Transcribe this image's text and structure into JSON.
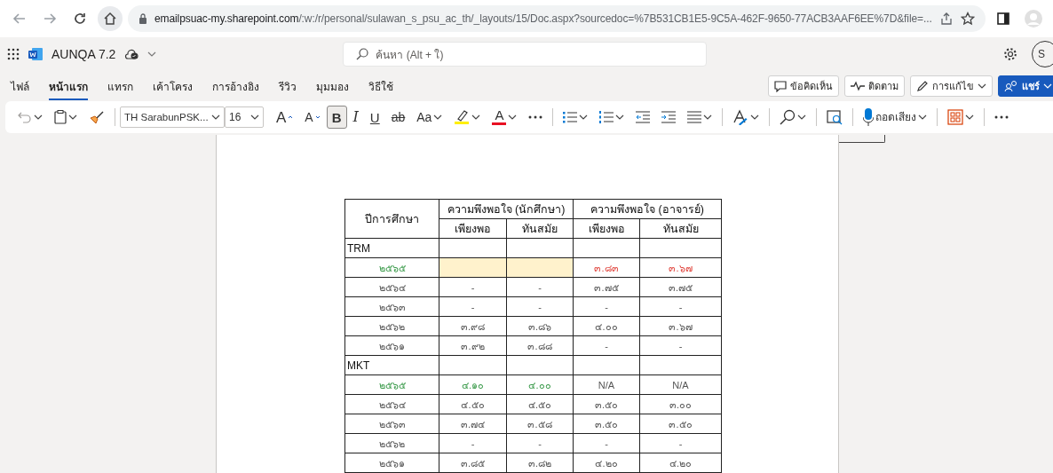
{
  "browser": {
    "url_host": "emailpsuac-my.sharepoint.com",
    "url_path": "/:w:/r/personal/sulawan_s_psu_ac_th/_layouts/15/Doc.aspx?sourcedoc=%7B531CB1E5-9C5A-462F-9650-77ACB3AAF6EE%7D&file=..."
  },
  "app": {
    "title": "AUNQA 7.2",
    "search": {
      "placeholder": "ค้นหา (Alt + ใ)"
    },
    "avatar": "S"
  },
  "ribbon_tabs": [
    {
      "label": "ไฟล์",
      "selected": false
    },
    {
      "label": "หน้าแรก",
      "selected": true
    },
    {
      "label": "แทรก",
      "selected": false
    },
    {
      "label": "เค้าโครง",
      "selected": false
    },
    {
      "label": "การอ้างอิง",
      "selected": false
    },
    {
      "label": "รีวิว",
      "selected": false
    },
    {
      "label": "มุมมอง",
      "selected": false
    },
    {
      "label": "วิธีใช้",
      "selected": false
    }
  ],
  "ribbon_actions": [
    {
      "kind": "comments",
      "label": "ข้อคิดเห็น"
    },
    {
      "kind": "catch-up",
      "label": "ติดตาม"
    },
    {
      "kind": "editing",
      "label": "การแก้ไข"
    },
    {
      "kind": "share",
      "label": "แชร์"
    }
  ],
  "toolbar": {
    "font": "TH SarabunPSK...",
    "size": "16",
    "items": [
      {
        "kind": "grow",
        "label": "A",
        "pressed": false
      },
      {
        "kind": "shrink",
        "label": "A",
        "pressed": false
      },
      {
        "kind": "bold",
        "label": "B",
        "pressed": true
      },
      {
        "kind": "italic",
        "label": "I",
        "pressed": false
      },
      {
        "kind": "underline",
        "label": "U",
        "pressed": false
      },
      {
        "kind": "strike",
        "label": "ab",
        "pressed": false
      },
      {
        "kind": "case",
        "label": "Aa",
        "pressed": false
      },
      {
        "kind": "highlight",
        "pressed": false
      },
      {
        "kind": "fontcolor",
        "label": "A",
        "pressed": false
      },
      {
        "kind": "more",
        "pressed": false
      },
      {
        "kind": "bullets",
        "pressed": false
      },
      {
        "kind": "numbering",
        "pressed": false
      },
      {
        "kind": "outdent",
        "pressed": false
      },
      {
        "kind": "indent",
        "pressed": false
      },
      {
        "kind": "align",
        "pressed": false
      },
      {
        "kind": "styles",
        "pressed": false
      },
      {
        "kind": "find",
        "pressed": false
      },
      {
        "kind": "designer",
        "pressed": false
      },
      {
        "kind": "dictate",
        "label": "ถอดเสียง",
        "pressed": false
      },
      {
        "kind": "addins",
        "pressed": false
      },
      {
        "kind": "more",
        "pressed": false
      }
    ]
  },
  "table": {
    "header": [
      "ปีการศึกษา",
      "ความพึงพอใจ (นักศึกษา)",
      "ความพึงพอใจ (อาจารย์)"
    ],
    "subheader": [
      "เพียงพอ",
      "ทันสมัย",
      "เพียงพอ",
      "ทันสมัย"
    ],
    "rows": [
      {
        "kind": "group",
        "label": "TRM"
      },
      {
        "kind": "data",
        "cells": [
          {
            "text": "๒๕๖๕",
            "color": "#3a9a4a",
            "highlighted": false
          },
          {
            "text": "",
            "highlighted": true
          },
          {
            "text": "",
            "highlighted": true
          },
          {
            "text": "๓.๘๓",
            "color": "#e0443c",
            "highlighted": false
          },
          {
            "text": "๓.๖๗",
            "color": "#e0443c",
            "highlighted": false
          }
        ]
      },
      {
        "kind": "data",
        "cells": [
          {
            "text": "๒๕๖๔",
            "highlighted": false
          },
          {
            "text": "-",
            "highlighted": false
          },
          {
            "text": "-",
            "highlighted": false
          },
          {
            "text": "๓.๗๕",
            "highlighted": false
          },
          {
            "text": "๓.๗๕",
            "highlighted": false
          }
        ]
      },
      {
        "kind": "data",
        "cells": [
          {
            "text": "๒๕๖๓",
            "highlighted": false
          },
          {
            "text": "-",
            "highlighted": false
          },
          {
            "text": "-",
            "highlighted": false
          },
          {
            "text": "-",
            "highlighted": false
          },
          {
            "text": "-",
            "highlighted": false
          }
        ]
      },
      {
        "kind": "data",
        "cells": [
          {
            "text": "๒๕๖๒",
            "highlighted": false
          },
          {
            "text": "๓.๙๘",
            "highlighted": false
          },
          {
            "text": "๓.๘๖",
            "highlighted": false
          },
          {
            "text": "๔.๐๐",
            "highlighted": false
          },
          {
            "text": "๓.๖๗",
            "highlighted": false
          }
        ]
      },
      {
        "kind": "data",
        "cells": [
          {
            "text": "๒๕๖๑",
            "highlighted": false
          },
          {
            "text": "๓.๙๒",
            "highlighted": false
          },
          {
            "text": "๓.๘๘",
            "highlighted": false
          },
          {
            "text": "-",
            "highlighted": false
          },
          {
            "text": "-",
            "highlighted": false
          }
        ]
      },
      {
        "kind": "group",
        "label": "MKT"
      },
      {
        "kind": "data",
        "cells": [
          {
            "text": "๒๕๖๕",
            "color": "#3a9a4a",
            "highlighted": false
          },
          {
            "text": "๔.๑๐",
            "color": "#3a9a4a",
            "highlighted": false
          },
          {
            "text": "๔.๐๐",
            "color": "#3a9a4a",
            "highlighted": false
          },
          {
            "text": "N/A",
            "highlighted": false
          },
          {
            "text": "N/A",
            "highlighted": false
          }
        ]
      },
      {
        "kind": "data",
        "cells": [
          {
            "text": "๒๕๖๔",
            "highlighted": false
          },
          {
            "text": "๔.๕๐",
            "highlighted": false
          },
          {
            "text": "๔.๕๐",
            "highlighted": false
          },
          {
            "text": "๓.๕๐",
            "highlighted": false
          },
          {
            "text": "๓.๐๐",
            "highlighted": false
          }
        ]
      },
      {
        "kind": "data",
        "cells": [
          {
            "text": "๒๕๖๓",
            "highlighted": false
          },
          {
            "text": "๓.๗๔",
            "highlighted": false
          },
          {
            "text": "๓.๕๘",
            "highlighted": false
          },
          {
            "text": "๓.๕๐",
            "highlighted": false
          },
          {
            "text": "๓.๕๐",
            "highlighted": false
          }
        ]
      },
      {
        "kind": "data",
        "cells": [
          {
            "text": "๒๕๖๒",
            "highlighted": false
          },
          {
            "text": "-",
            "highlighted": false
          },
          {
            "text": "-",
            "highlighted": false
          },
          {
            "text": "-",
            "highlighted": false
          },
          {
            "text": "-",
            "highlighted": false
          }
        ]
      },
      {
        "kind": "data",
        "cells": [
          {
            "text": "๒๕๖๑",
            "highlighted": false
          },
          {
            "text": "๓.๘๕",
            "highlighted": false
          },
          {
            "text": "๓.๘๒",
            "highlighted": false
          },
          {
            "text": "๔.๒๐",
            "highlighted": false
          },
          {
            "text": "๔.๒๐",
            "highlighted": false
          }
        ]
      }
    ]
  }
}
